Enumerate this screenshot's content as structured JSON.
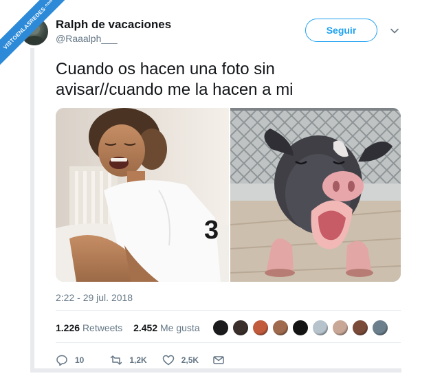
{
  "watermark": {
    "text": "VISTOENLASREDES",
    "domain": ".com"
  },
  "author": {
    "display_name": "Ralph de vacaciones",
    "handle": "@Raaalph___"
  },
  "follow_button": {
    "label": "Seguir"
  },
  "tweet": {
    "line1": "Cuando os hacen una foto sin",
    "line2": "avisar//cuando me la hacen a mi",
    "timestamp": "2:22 - 29 jul. 2018"
  },
  "stats": {
    "retweets_count": "1.226",
    "retweets_label": "Retweets",
    "likes_count": "2.452",
    "likes_label": "Me gusta"
  },
  "likers_colors": [
    "#1b1b1e",
    "#3a2f2a",
    "#c25a3c",
    "#a06a4e",
    "#141414",
    "#b7c3cc",
    "#c9a797",
    "#7b4b3a",
    "#6b7f8d"
  ],
  "actions": {
    "replies": "10",
    "retweets": "1,2K",
    "likes": "2,5K"
  },
  "icons": {
    "chevron": "chevron-down-icon",
    "reply": "reply-icon",
    "retweet": "retweet-icon",
    "like": "heart-icon",
    "message": "mail-icon"
  },
  "colors": {
    "accent": "#1da1f2",
    "muted": "#657786",
    "text": "#14171a",
    "watermark": "#2d8ad8"
  }
}
